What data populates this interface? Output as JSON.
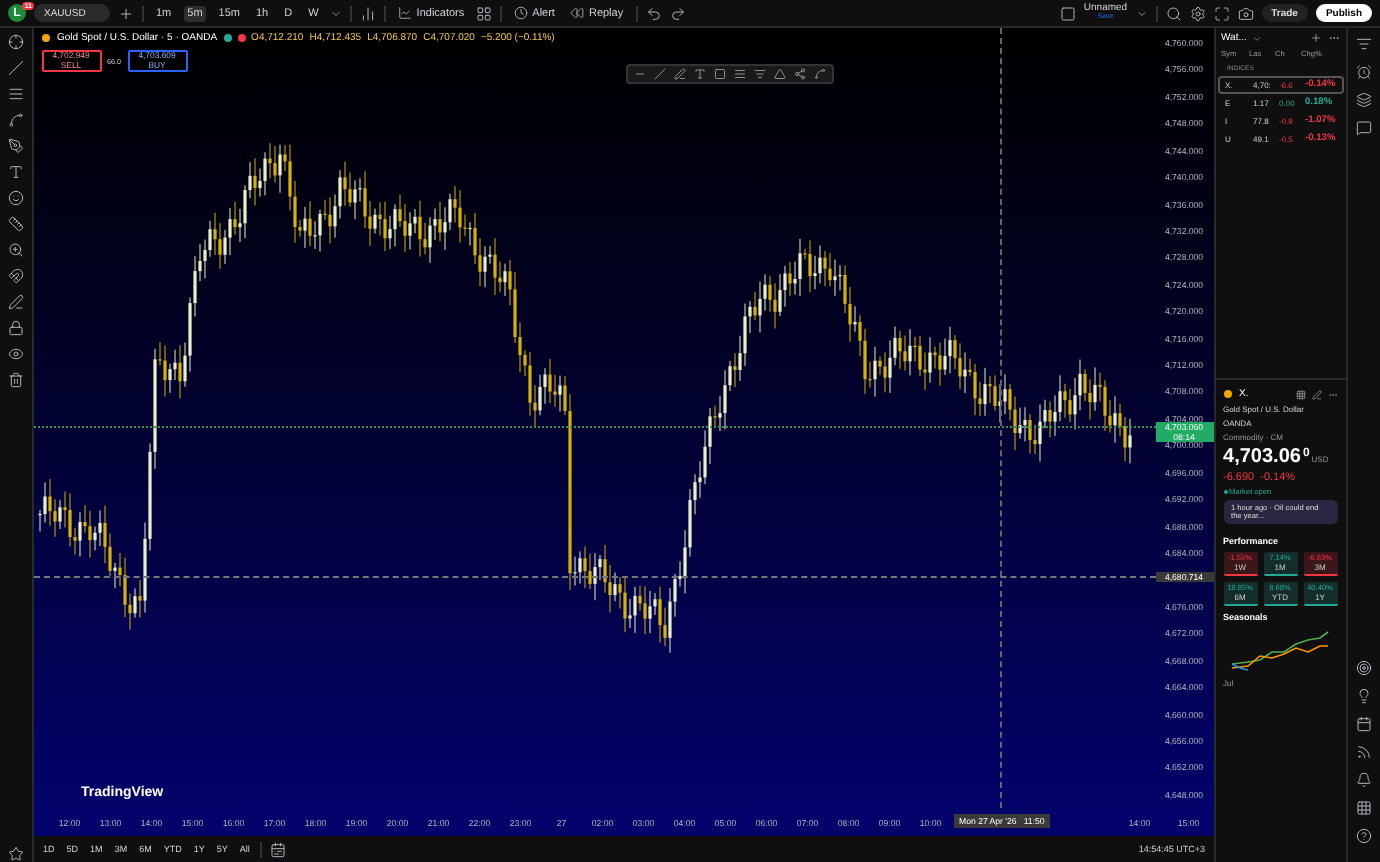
{
  "top_bar": {
    "avatar": "L",
    "badge": "11",
    "symbol": "XAUUSD",
    "intervals": [
      {
        "label": "1m",
        "selected": false
      },
      {
        "label": "5m",
        "selected": true
      },
      {
        "label": "15m",
        "selected": false
      },
      {
        "label": "1h",
        "selected": false
      },
      {
        "label": "D",
        "selected": false
      },
      {
        "label": "W",
        "selected": false
      }
    ],
    "indicators": "Indicators",
    "alert": "Alert",
    "replay": "Replay",
    "layout_name": "Unnamed",
    "layout_status": "Save",
    "trade": "Trade",
    "publish": "Publish"
  },
  "legend": {
    "title": "Gold Spot / U.S. Dollar · 5 · OANDA",
    "ohlc": [
      {
        "label": "O",
        "value": "4,712.210"
      },
      {
        "label": "H",
        "value": "4,712.435"
      },
      {
        "label": "L",
        "value": "4,706.870"
      },
      {
        "label": "C",
        "value": "4,707.020"
      }
    ],
    "change": "−5.200 (−0.11%)",
    "sell": {
      "price": "4,702.949",
      "label": "SELL"
    },
    "spread": "66.0",
    "buy": {
      "price": "4,703.609",
      "label": "BUY"
    }
  },
  "price_axis": [
    "4,760.000",
    "4,756.000",
    "4,752.000",
    "4,748.000",
    "4,744.000",
    "4,740.000",
    "4,736.000",
    "4,732.000",
    "4,728.000",
    "4,724.000",
    "4,720.000",
    "4,716.000",
    "4,712.000",
    "4,708.000",
    "4,704.000",
    "4,700.000",
    "4,696.000",
    "4,692.000",
    "4,688.000",
    "4,684.000",
    "4,676.000",
    "4,672.000",
    "4,668.000",
    "4,664.000",
    "4,660.000",
    "4,656.000",
    "4,652.000",
    "4,648.000"
  ],
  "last_price": {
    "price": "4,703.060",
    "countdown": "08:14"
  },
  "crosshair": {
    "price": "4,680.714",
    "time": "Mon 27 Apr '26   11:50"
  },
  "time_axis": [
    "12:00",
    "13:00",
    "14:00",
    "15:00",
    "16:00",
    "17:00",
    "18:00",
    "19:00",
    "20:00",
    "21:00",
    "22:00",
    "23:00",
    "27",
    "02:00",
    "03:00",
    "04:00",
    "05:00",
    "06:00",
    "07:00",
    "08:00",
    "09:00",
    "10:00",
    "14:00",
    "15:00"
  ],
  "brand": "TradingView",
  "ranges": [
    "1D",
    "5D",
    "1M",
    "3M",
    "6M",
    "YTD",
    "1Y",
    "5Y",
    "All"
  ],
  "clock": "14:54:45 UTC+3",
  "watchlist": {
    "title": "Wat...",
    "columns": [
      "Sym",
      "Las",
      "Ch",
      "Chg%"
    ],
    "section": "INDICES",
    "rows": [
      {
        "symbol": "X.",
        "last": "4,70:",
        "change": "-6.6",
        "change_pct": "-0.14%",
        "color": "#f23645",
        "selected": true
      },
      {
        "symbol": "E",
        "last": "1.17",
        "change": "0.00",
        "change_pct": "0.18%",
        "color": "#22ab94",
        "selected": false
      },
      {
        "symbol": "I",
        "last": "77.8",
        "change": "-0.9",
        "change_pct": "-1.07%",
        "color": "#f23645",
        "selected": false
      },
      {
        "symbol": "U",
        "last": "49.1",
        "change": "-0.5",
        "change_pct": "-0.13%",
        "color": "#f23645",
        "selected": false
      }
    ]
  },
  "details": {
    "symbol": "X.",
    "name": "Gold Spot / U.S. Dollar",
    "exchange": "OANDA",
    "category": "Commodity · CM",
    "price": "4,703.06",
    "price_tail": "0",
    "currency": "USD",
    "change": "-6.690",
    "change_pct": "-0.14%",
    "status": "Market open",
    "news": "1 hour ago · Oil could end the year..."
  },
  "performance": {
    "title": "Performance",
    "cells": [
      {
        "value": "-1.55%",
        "period": "1W",
        "color": "#f23645"
      },
      {
        "value": "7.14%",
        "period": "1M",
        "color": "#22ab94"
      },
      {
        "value": "-6.63%",
        "period": "3M",
        "color": "#f23645"
      },
      {
        "value": "18.85%",
        "period": "6M",
        "color": "#22ab94"
      },
      {
        "value": "8.68%",
        "period": "YTD",
        "color": "#22ab94"
      },
      {
        "value": "40.40%",
        "period": "1Y",
        "color": "#22ab94"
      }
    ]
  },
  "seasonals": {
    "title": "Seasonals",
    "month": "Jul"
  }
}
